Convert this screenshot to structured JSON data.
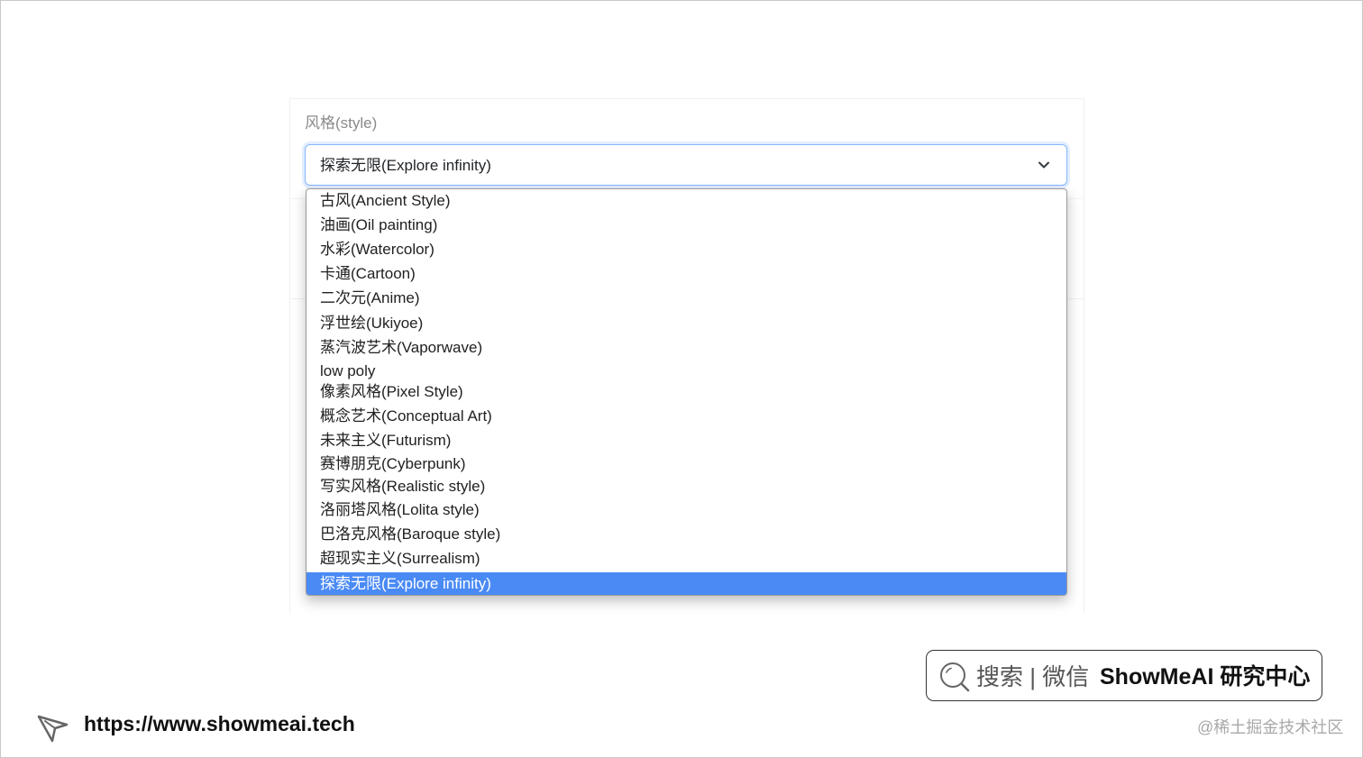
{
  "form": {
    "label": "风格(style)",
    "selected_value": "探索无限(Explore infinity)"
  },
  "dropdown": {
    "options": [
      "古风(Ancient Style)",
      "油画(Oil painting)",
      "水彩(Watercolor)",
      "卡通(Cartoon)",
      "二次元(Anime)",
      "浮世绘(Ukiyoe)",
      "蒸汽波艺术(Vaporwave)",
      "low poly",
      "像素风格(Pixel Style)",
      "概念艺术(Conceptual Art)",
      "未来主义(Futurism)",
      "赛博朋克(Cyberpunk)",
      "写实风格(Realistic style)",
      "洛丽塔风格(Lolita style)",
      "巴洛克风格(Baroque style)",
      "超现实主义(Surrealism)",
      "探索无限(Explore infinity)"
    ],
    "selected_index": 16,
    "highlight_color": "#4a8af4"
  },
  "footer": {
    "search_text": "搜索 | 微信",
    "brand": "ShowMeAI 研究中心",
    "url": "https://www.showmeai.tech",
    "watermark": "@稀土掘金技术社区"
  },
  "icons": {
    "select_chevron": "chevron-down-icon",
    "search": "search-icon",
    "cursor": "cursor-arrow-icon"
  }
}
